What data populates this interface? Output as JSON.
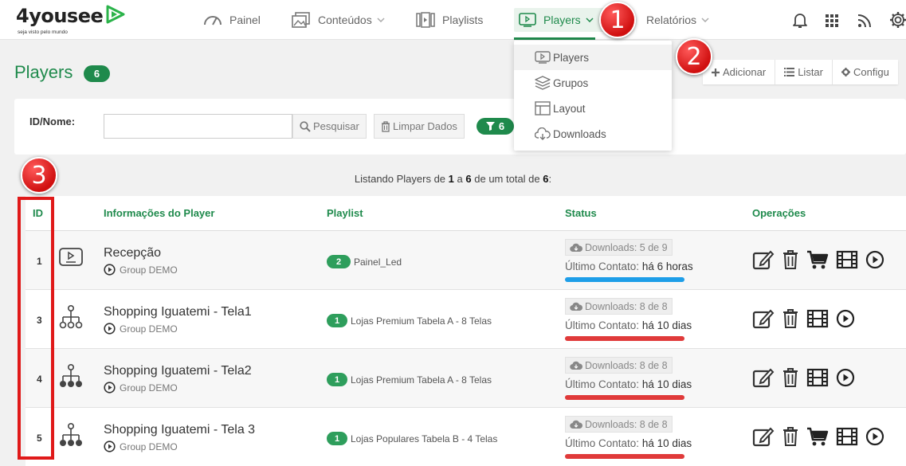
{
  "logo": {
    "text": "4yousee",
    "tagline": "seja visto pelo mundo",
    "accent": "#2bb34a"
  },
  "nav": {
    "painel": "Painel",
    "conteudos": "Conteúdos",
    "playlists": "Playlists",
    "players": "Players",
    "relatorios": "Relatórios"
  },
  "dropdown": {
    "items": [
      "Players",
      "Grupos",
      "Layout",
      "Downloads"
    ]
  },
  "page": {
    "title": "Players",
    "count": "6"
  },
  "actions": {
    "add": "Adicionar",
    "list": "Listar",
    "config": "Configu"
  },
  "filter": {
    "label": "ID/Nome:",
    "value": "",
    "search": "Pesquisar",
    "clear": "Limpar Dados",
    "count": "6"
  },
  "listing": {
    "prefix": "Listando Players de",
    "from": "1",
    "mid": "a",
    "to": "6",
    "suffix": "de um total de",
    "total": "6",
    "end": ":"
  },
  "table": {
    "headers": {
      "id": "ID",
      "info": "Informações do Player",
      "playlist": "Playlist",
      "status": "Status",
      "ops": "Operações"
    },
    "rows": [
      {
        "id": "1",
        "name": "Recepção",
        "group": "Group DEMO",
        "playlist_count": "2",
        "playlist": "Painel_Led",
        "downloads": "Downloads: 5 de 9",
        "contact_label": "Último Contato:",
        "contact_value": "há 6 horas",
        "status_color": "#1e9ee8",
        "icon": "monitor-icon",
        "cart": true
      },
      {
        "id": "3",
        "name": "Shopping Iguatemi - Tela1",
        "group": "Group DEMO",
        "playlist_count": "1",
        "playlist": "Lojas Premium Tabela A - 8 Telas",
        "downloads": "Downloads: 8 de 8",
        "contact_label": "Último Contato:",
        "contact_value": "há 10 dias",
        "status_color": "#e03a3a",
        "icon": "hierarchy-outline-icon",
        "cart": false
      },
      {
        "id": "4",
        "name": "Shopping Iguatemi - Tela2",
        "group": "Group DEMO",
        "playlist_count": "1",
        "playlist": "Lojas Premium Tabela A - 8 Telas",
        "downloads": "Downloads: 8 de 8",
        "contact_label": "Último Contato:",
        "contact_value": "há 10 dias",
        "status_color": "#e03a3a",
        "icon": "hierarchy-filled-icon",
        "cart": false
      },
      {
        "id": "5",
        "name": "Shopping Iguatemi - Tela 3",
        "group": "Group DEMO",
        "playlist_count": "1",
        "playlist": "Lojas Populares Tabela B - 4 Telas",
        "downloads": "Downloads: 8 de 8",
        "contact_label": "Último Contato:",
        "contact_value": "há 10 dias",
        "status_color": "#e03a3a",
        "icon": "hierarchy-outline-icon",
        "cart": true
      }
    ]
  },
  "markers": [
    "1",
    "2",
    "3"
  ],
  "colors": {
    "brand": "#1f8a4c",
    "marker": "#e01919"
  }
}
